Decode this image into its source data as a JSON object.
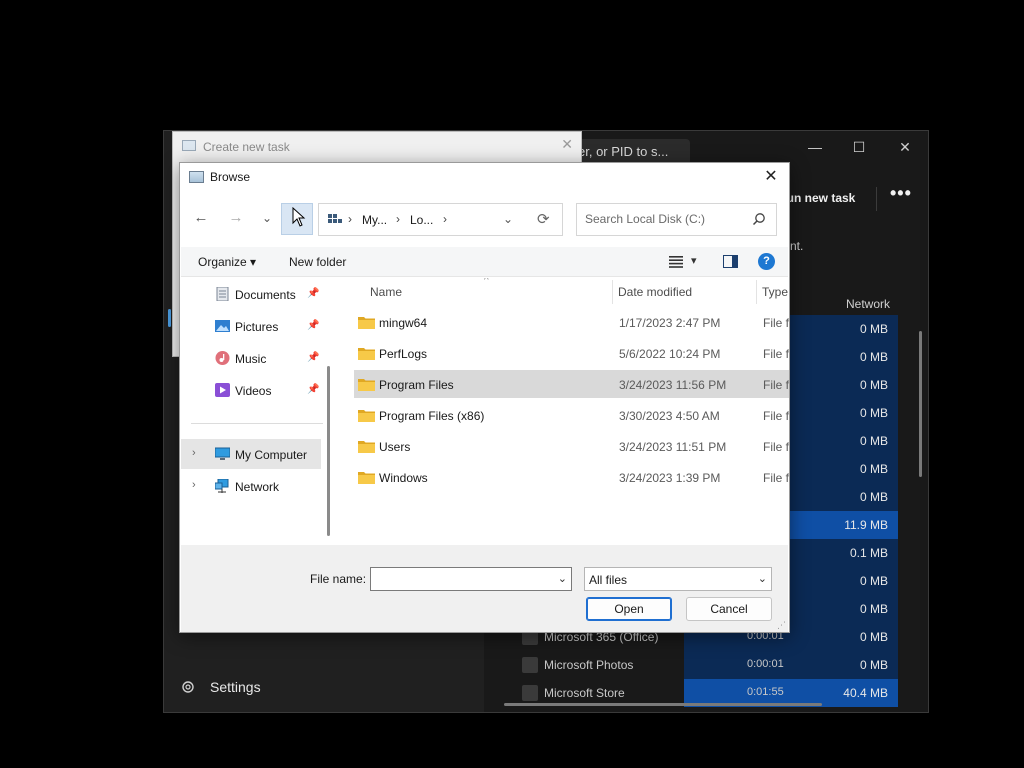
{
  "taskmanager": {
    "search_text": "er, or PID to s...",
    "minimize": "—",
    "maximize": "☐",
    "close": "✕",
    "run_new_task": "Run new task",
    "more": "•••",
    "subtext": "nt.",
    "network_header": "Network",
    "settings_label": "Settings",
    "rows": [
      {
        "network": "0 MB",
        "highlight": false
      },
      {
        "network": "0 MB",
        "highlight": false
      },
      {
        "network": "0 MB",
        "highlight": false
      },
      {
        "network": "0 MB",
        "highlight": false
      },
      {
        "network": "0 MB",
        "highlight": false
      },
      {
        "network": "0 MB",
        "highlight": false
      },
      {
        "network": "0 MB",
        "highlight": false
      },
      {
        "network": "11.9 MB",
        "highlight": true
      },
      {
        "network": "0.1 MB",
        "highlight": false
      },
      {
        "network": "0 MB",
        "highlight": false
      },
      {
        "network": "0 MB",
        "highlight": false
      },
      {
        "network": "0 MB",
        "highlight": false,
        "name": "Microsoft 365 (Office)",
        "time": "0:00:01"
      },
      {
        "network": "0 MB",
        "highlight": false,
        "name": "Microsoft Photos",
        "time": "0:00:01"
      },
      {
        "network": "40.4 MB",
        "highlight": true,
        "name": "Microsoft Store",
        "time": "0:01:55"
      }
    ]
  },
  "create_task": {
    "title": "Create new task",
    "close": "✕"
  },
  "browse": {
    "title": "Browse",
    "close": "✕",
    "nav": {
      "back": "←",
      "forward": "→",
      "recent": "⌄",
      "up": "↑"
    },
    "address": {
      "segments": [
        "My...",
        "Lo..."
      ],
      "separator": "›",
      "dropdown": "⌄",
      "refresh": "⟳"
    },
    "search_placeholder": "Search Local Disk (C:)",
    "toolbar": {
      "organize": "Organize ▾",
      "new_folder": "New folder",
      "view_caret": "▾",
      "help": "?"
    },
    "navpane": {
      "quick": [
        {
          "label": "Documents",
          "icon": "documents-icon"
        },
        {
          "label": "Pictures",
          "icon": "pictures-icon"
        },
        {
          "label": "Music",
          "icon": "music-icon"
        },
        {
          "label": "Videos",
          "icon": "videos-icon"
        }
      ],
      "pin": "📌",
      "tree": [
        {
          "label": "My Computer",
          "icon": "computer-icon",
          "selected": true
        },
        {
          "label": "Network",
          "icon": "network-icon",
          "selected": false
        }
      ],
      "expander": "›"
    },
    "columns": {
      "name": "Name",
      "date": "Date modified",
      "type": "Type",
      "sort_caret": "^"
    },
    "files": [
      {
        "name": "mingw64",
        "date": "1/17/2023 2:47 PM",
        "type": "File fo",
        "selected": false
      },
      {
        "name": "PerfLogs",
        "date": "5/6/2022 10:24 PM",
        "type": "File fo",
        "selected": false
      },
      {
        "name": "Program Files",
        "date": "3/24/2023 11:56 PM",
        "type": "File fo",
        "selected": true
      },
      {
        "name": "Program Files (x86)",
        "date": "3/30/2023 4:50 AM",
        "type": "File fo",
        "selected": false
      },
      {
        "name": "Users",
        "date": "3/24/2023 11:51 PM",
        "type": "File fo",
        "selected": false
      },
      {
        "name": "Windows",
        "date": "3/24/2023 1:39 PM",
        "type": "File fo",
        "selected": false
      }
    ],
    "file_name_label": "File name:",
    "file_name_value": "",
    "file_type": "All files",
    "dropdown_caret": "⌄",
    "open_label": "Open",
    "cancel_label": "Cancel",
    "grip": "⋰",
    "colors": {
      "selection": "#d9d9d9",
      "accent": "#1f6fd1",
      "folder": "#f5c242"
    }
  }
}
